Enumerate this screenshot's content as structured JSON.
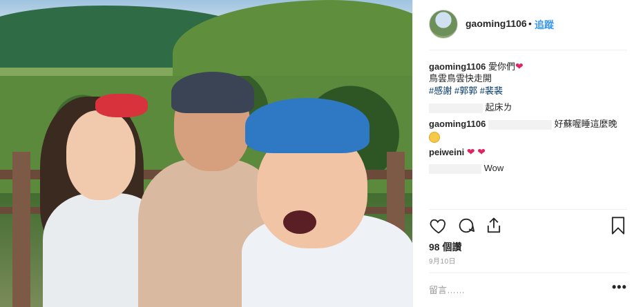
{
  "post": {
    "username": "gaoming1106",
    "separator": "•",
    "follow_label": "追蹤",
    "likes": "98 個讚",
    "date": "9月10日",
    "add_comment_placeholder": "留言……",
    "more_label": "•••"
  },
  "caption": {
    "username": "gaoming1106",
    "text": "愛你們",
    "line2": "鳥雲鳥雲快走開",
    "hashtags": [
      "#感謝",
      "#郭郭",
      "#裴裴"
    ]
  },
  "comments": [
    {
      "username": "",
      "text": "起床ㄌ"
    },
    {
      "username": "gaoming1106",
      "text": "好蘇喔睡這麼晚"
    },
    {
      "username": "peiweini",
      "text": ""
    },
    {
      "username": "",
      "text": "Wow"
    }
  ],
  "icons": [
    "heart-icon",
    "comment-icon",
    "share-icon",
    "bookmark-icon",
    "heart-emoji-icon",
    "smile-emoji-icon"
  ],
  "colors": {
    "follow": "#3897f0",
    "hashtag": "#003569",
    "heart": "#e0245e",
    "muted": "#999999"
  }
}
